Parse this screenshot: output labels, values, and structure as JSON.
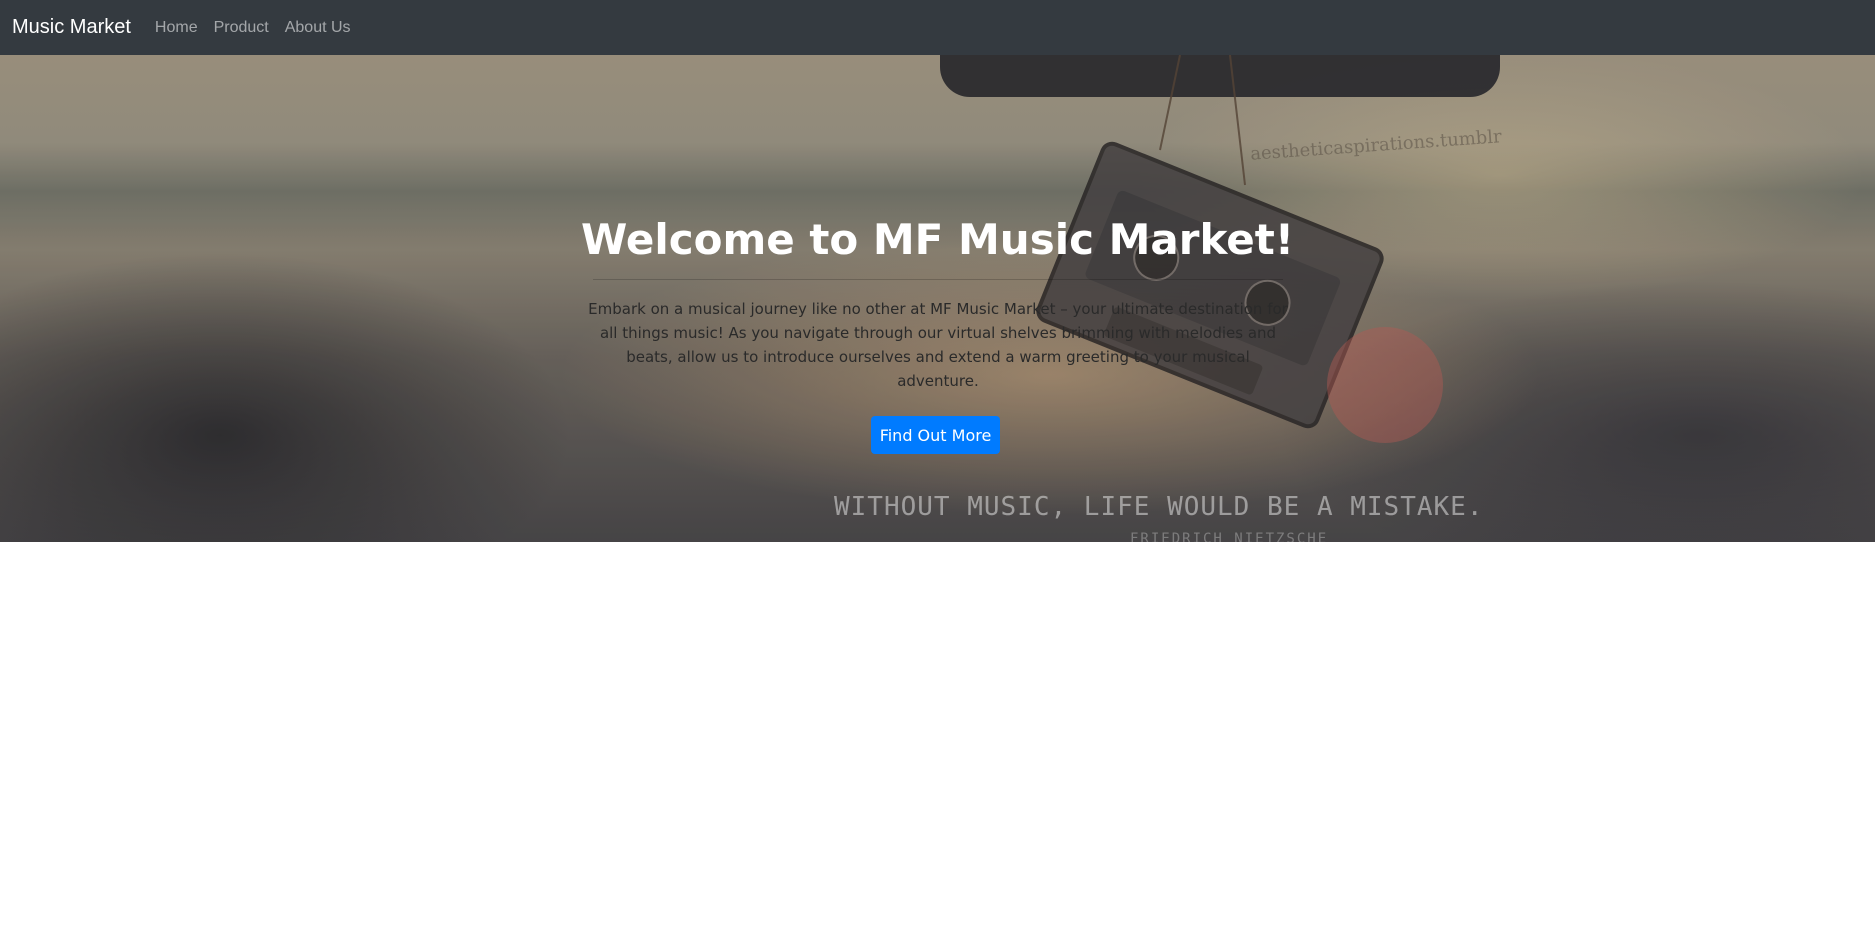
{
  "navbar": {
    "brand": "Music Market",
    "links": [
      "Home",
      "Product",
      "About Us"
    ],
    "background_color": "#343a40"
  },
  "hero": {
    "title": "Welcome to MF Music Market!",
    "lead": "Embark on a musical journey like no other at MF Music Market – your ultimate destination for all things music! As you navigate through our virtual shelves brimming with melodies and beats, allow us to introduce ourselves and extend a warm greeting to your musical adventure.",
    "button_label": "Find Out More",
    "button_color": "#007bff",
    "background_image": {
      "quote": "WITHOUT MUSIC, LIFE WOULD BE A MISTAKE.",
      "quote_author": "FRIEDRICH NIETZSCHE",
      "watermark": "aestheticaspirations.tumblr"
    }
  }
}
